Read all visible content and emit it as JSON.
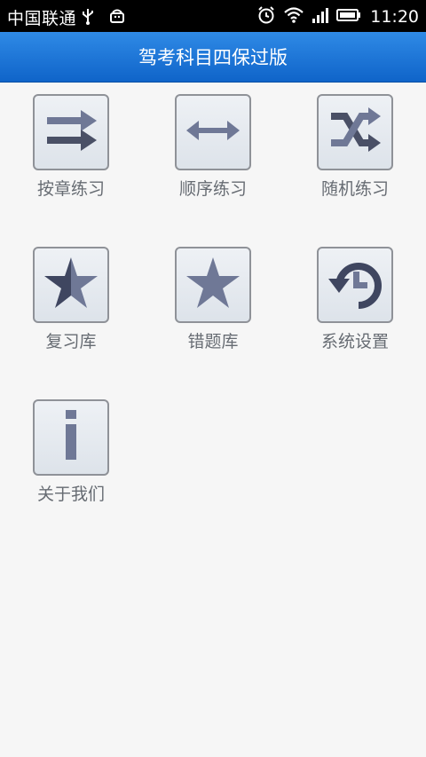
{
  "status": {
    "carrier": "中国联通",
    "time": "11:20"
  },
  "header": {
    "title": "驾考科目四保过版"
  },
  "menu": [
    {
      "label": "按章练习",
      "icon": "two-right-arrows-icon"
    },
    {
      "label": "顺序练习",
      "icon": "double-arrow-icon"
    },
    {
      "label": "随机练习",
      "icon": "shuffle-icon"
    },
    {
      "label": "复习库",
      "icon": "half-star-icon"
    },
    {
      "label": "错题库",
      "icon": "star-icon"
    },
    {
      "label": "系统设置",
      "icon": "history-clock-icon"
    },
    {
      "label": "关于我们",
      "icon": "info-icon"
    }
  ],
  "colors": {
    "header_top": "#2f8ae6",
    "header_bottom": "#0f64c9",
    "icon_main": "#6f7896",
    "icon_dark": "#4a5066",
    "label": "#666b72"
  }
}
